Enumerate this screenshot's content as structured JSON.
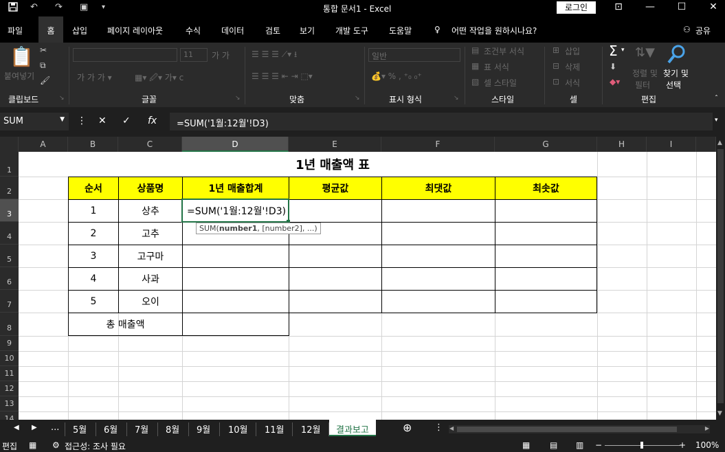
{
  "titlebar": {
    "title": "통합 문서1  -  Excel",
    "login_label": "로그인",
    "save_icon": "floppy-disk-icon",
    "undo_icon": "undo-icon",
    "redo_icon": "redo-icon",
    "camera_icon": "camera-icon"
  },
  "menu": {
    "items": [
      "파일",
      "홈",
      "삽입",
      "페이지 레이아웃",
      "수식",
      "데이터",
      "검토",
      "보기",
      "개발 도구",
      "도움말"
    ],
    "tell_me": "어떤 작업을 원하시나요?",
    "share": "공유"
  },
  "ribbon": {
    "clipboard": {
      "paste": "붙여넣기",
      "label": "클립보드"
    },
    "font": {
      "size": "11",
      "label": "글꼴"
    },
    "align": {
      "label": "맞춤"
    },
    "number": {
      "format": "일반",
      "label": "표시 형식"
    },
    "styles": {
      "cond": "조건부 서식",
      "table": "표 서식",
      "cell": "셀 스타일",
      "label": "스타일"
    },
    "cells": {
      "insert": "삽입",
      "delete": "삭제",
      "format": "서식",
      "label": "셀"
    },
    "edit": {
      "sort": "정렬 및",
      "filter": "필터",
      "find": "찾기 및",
      "select": "선택",
      "label": "편집"
    }
  },
  "formula_bar": {
    "name_box": "SUM",
    "formula": "=SUM('1월:12월'!D3)"
  },
  "sheet": {
    "columns": [
      "A",
      "B",
      "C",
      "D",
      "E",
      "F",
      "G",
      "H",
      "I"
    ],
    "rows": [
      "1",
      "2",
      "3",
      "4",
      "5",
      "6",
      "7",
      "8",
      "9",
      "10",
      "11",
      "12",
      "13",
      "14"
    ],
    "title": "1년 매출액 표",
    "headers": [
      "순서",
      "상품명",
      "1년 매출합계",
      "평균값",
      "최댓값",
      "최솟값"
    ],
    "data": [
      [
        "1",
        "상추"
      ],
      [
        "2",
        "고추"
      ],
      [
        "3",
        "고구마"
      ],
      [
        "4",
        "사과"
      ],
      [
        "5",
        "오이"
      ]
    ],
    "total_label": "총 매출액",
    "active_cell_text": "=SUM('1월:12월'!D3)",
    "tooltip_fn": "SUM(",
    "tooltip_arg1": "number1",
    "tooltip_rest": ", [number2], ...)"
  },
  "tabs": {
    "ellipsis": "...",
    "items": [
      "5월",
      "6월",
      "7월",
      "8월",
      "9월",
      "10월",
      "11월",
      "12월"
    ],
    "active": "결과보고"
  },
  "status": {
    "mode": "편집",
    "accessibility": "접근성: 조사 필요",
    "zoom": "100%"
  }
}
